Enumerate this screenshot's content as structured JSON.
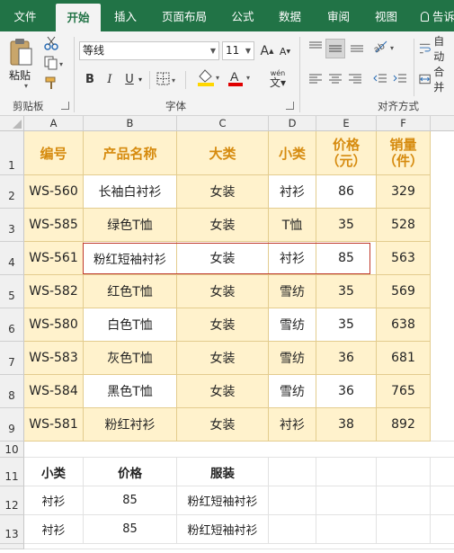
{
  "ribbon_tabs": [
    "文件",
    "开始",
    "插入",
    "页面布局",
    "公式",
    "数据",
    "审阅",
    "视图"
  ],
  "tell_me": "告诉",
  "clipboard": {
    "paste_label": "粘贴",
    "group_label": "剪贴板"
  },
  "font": {
    "name": "等线",
    "size": "11",
    "bold": "B",
    "italic": "I",
    "underline": "U",
    "grow": "A",
    "shrink": "A",
    "font_color": "A",
    "phonetic_top": "wén",
    "group_label": "字体"
  },
  "alignment": {
    "wrap_label": "自动",
    "merge_label": "合并",
    "group_label": "对齐方式"
  },
  "accent_colors": {
    "ribbon": "#217346",
    "header_text": "#d68b0f",
    "fill": "#fff2cc",
    "selection_border": "#c0392b"
  },
  "columns": [
    "A",
    "B",
    "C",
    "D",
    "E",
    "F"
  ],
  "rows": [
    "1",
    "2",
    "3",
    "4",
    "5",
    "6",
    "7",
    "8",
    "9",
    "10",
    "11",
    "12",
    "13"
  ],
  "table": {
    "headers": [
      "编号",
      "产品名称",
      "大类",
      "小类",
      "价格\n（元）",
      "销量\n（件）"
    ],
    "rows": [
      [
        "WS-560",
        "长袖白衬衫",
        "女装",
        "衬衫",
        "86",
        "329"
      ],
      [
        "WS-585",
        "绿色T恤",
        "女装",
        "T恤",
        "35",
        "528"
      ],
      [
        "WS-561",
        "粉红短袖衬衫",
        "女装",
        "衬衫",
        "85",
        "563"
      ],
      [
        "WS-582",
        "红色T恤",
        "女装",
        "雪纺",
        "35",
        "569"
      ],
      [
        "WS-580",
        "白色T恤",
        "女装",
        "雪纺",
        "35",
        "638"
      ],
      [
        "WS-583",
        "灰色T恤",
        "女装",
        "雪纺",
        "36",
        "681"
      ],
      [
        "WS-584",
        "黑色T恤",
        "女装",
        "雪纺",
        "36",
        "765"
      ],
      [
        "WS-581",
        "粉红衬衫",
        "女装",
        "衬衫",
        "38",
        "892"
      ]
    ]
  },
  "lookup": {
    "headers": [
      "小类",
      "价格",
      "服装"
    ],
    "rows": [
      [
        "衬衫",
        "85",
        "粉红短袖衬衫"
      ],
      [
        "衬衫",
        "85",
        "粉红短袖衬衫"
      ]
    ]
  }
}
